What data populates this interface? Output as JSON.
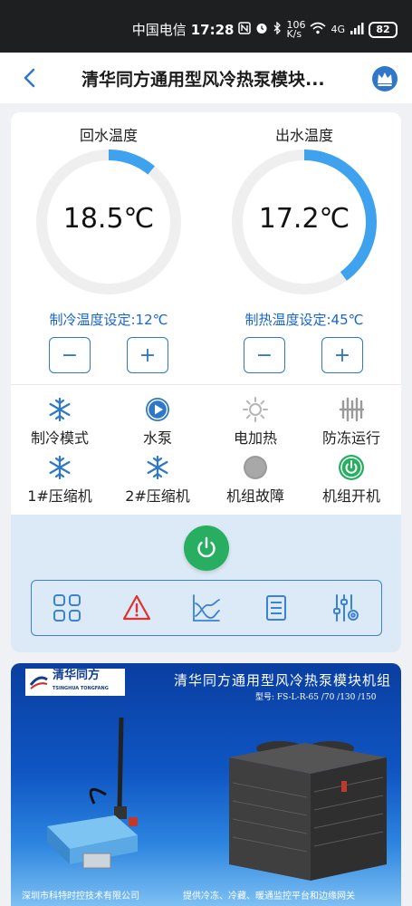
{
  "status_bar": {
    "carrier": "中国电信",
    "time": "17:28",
    "speed_value": "106",
    "speed_unit": "K/s",
    "network": "4G",
    "battery": "82"
  },
  "header": {
    "title": "清华同方通用型风冷热泵模块..."
  },
  "gauges": [
    {
      "title": "回水温度",
      "value": "18.5℃",
      "fill_fraction": 0.11,
      "setpoint_label": "制冷温度设定:12℃"
    },
    {
      "title": "出水温度",
      "value": "17.2℃",
      "fill_fraction": 0.4,
      "setpoint_label": "制热温度设定:45℃"
    }
  ],
  "steppers": {
    "minus": "−",
    "plus": "+"
  },
  "status_items": [
    {
      "label": "制冷模式",
      "icon": "snowflake-icon"
    },
    {
      "label": "水泵",
      "icon": "pump-play-icon"
    },
    {
      "label": "电加热",
      "icon": "sun-heater-icon"
    },
    {
      "label": "防冻运行",
      "icon": "antifreeze-icon"
    },
    {
      "label": "1#压缩机",
      "icon": "snowflake-icon"
    },
    {
      "label": "2#压缩机",
      "icon": "snowflake-icon"
    },
    {
      "label": "机组故障",
      "icon": "fault-indicator-icon"
    },
    {
      "label": "机组开机",
      "icon": "power-on-icon"
    }
  ],
  "colors": {
    "accent": "#2f77c9",
    "gauge_fill": "#3fa2ee",
    "power_green": "#27ae60",
    "alarm_red": "#e03131",
    "panel_bg": "#dbeaf6"
  },
  "toolbar": [
    {
      "icon": "grid-icon"
    },
    {
      "icon": "alarm-warning-icon"
    },
    {
      "icon": "curve-chart-icon"
    },
    {
      "icon": "list-document-icon"
    },
    {
      "icon": "sliders-settings-icon"
    }
  ],
  "banner": {
    "logo_name": "清华同方",
    "logo_sub": "TSINGHUA TONGFANG",
    "title": "清华同方通用型风冷热泵模块机组",
    "model": "型号: FS-L-R-65 /70 /130 /150",
    "footer_left": "深圳市科特时控技术有限公司",
    "footer_right": "提供冷冻、冷藏、暖通监控平台和边缘网关"
  }
}
